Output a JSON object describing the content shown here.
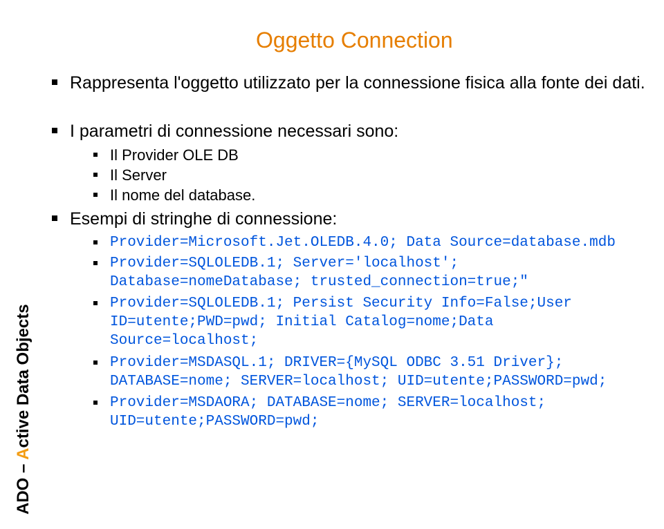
{
  "sidebar": {
    "prefix": "ADO – ",
    "highlight": "A",
    "rest": "ctive Data Objects"
  },
  "title": "Oggetto Connection",
  "bullet1": "Rappresenta l'oggetto utilizzato per la connessione fisica alla fonte dei dati.",
  "bullet2": "I parametri di connessione necessari sono:",
  "sub1": "Il Provider OLE DB",
  "sub2": "Il Server",
  "sub3": "Il nome del database.",
  "bullet3": "Esempi di stringhe di connessione:",
  "code1": "Provider=Microsoft.Jet.OLEDB.4.0; Data Source=database.mdb",
  "code2a": "Provider=SQLOLEDB.1; Server='localhost';",
  "code2b": "Database=nomeDatabase; trusted_connection=true;\"",
  "code3a": "Provider=SQLOLEDB.1; Persist Security Info=False;User",
  "code3b": "ID=utente;PWD=pwd; Initial Catalog=nome;Data",
  "code3c": "Source=localhost;",
  "code4a": "Provider=MSDASQL.1; DRIVER={MySQL ODBC 3.51 Driver};",
  "code4b": "DATABASE=nome; SERVER=localhost; UID=utente;PASSWORD=pwd;",
  "code5a": "Provider=MSDAORA; DATABASE=nome; SERVER=localhost;",
  "code5b": "UID=utente;PASSWORD=pwd;"
}
